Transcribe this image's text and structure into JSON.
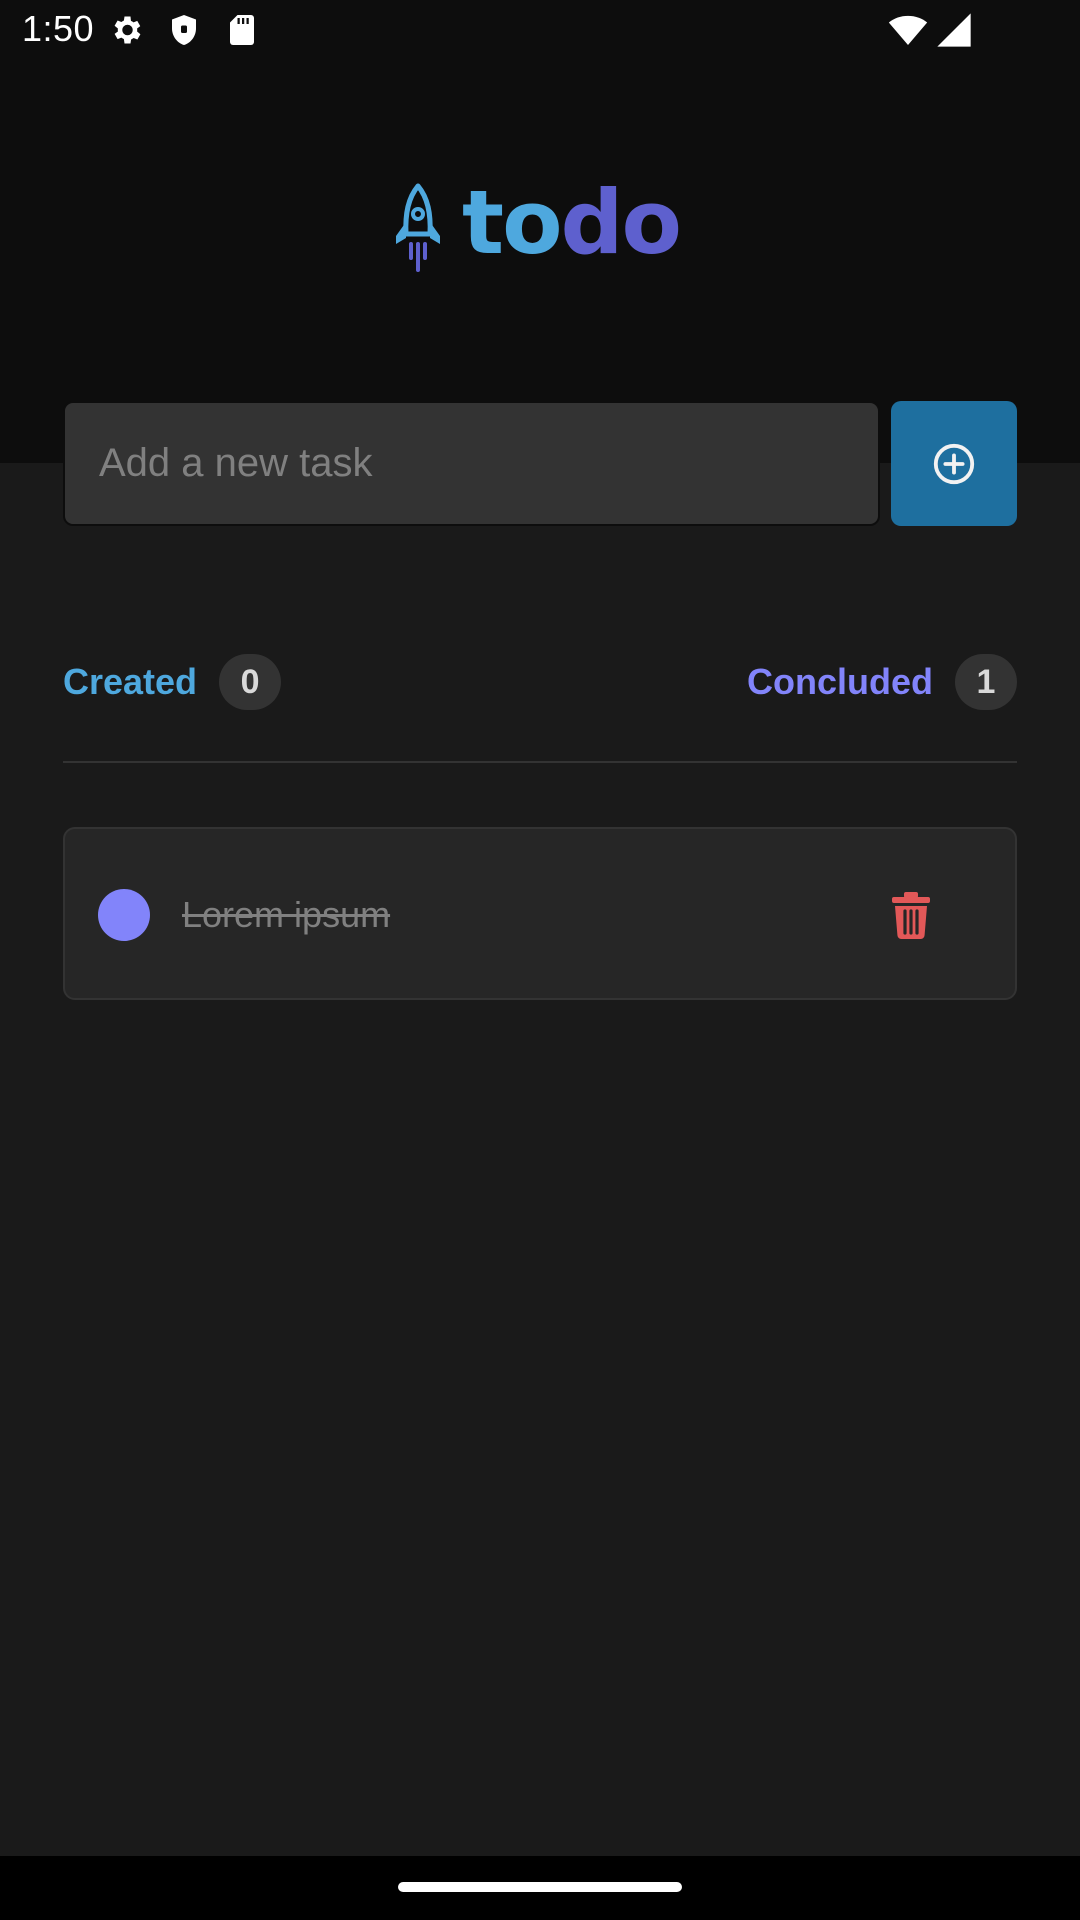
{
  "status_bar": {
    "time": "1:50",
    "icons": [
      "settings-icon",
      "shield-icon",
      "sd-card-icon",
      "wifi-icon",
      "signal-icon"
    ]
  },
  "logo": {
    "icon": "rocket-icon",
    "text_part1": "to",
    "text_part2": "do"
  },
  "new_task": {
    "placeholder": "Add a new task",
    "value": "",
    "button_icon": "plus-circle-icon"
  },
  "counters": {
    "created_label": "Created",
    "created_count": "0",
    "concluded_label": "Concluded",
    "concluded_count": "1"
  },
  "tasks": [
    {
      "text": "Lorem ipsum",
      "done": true,
      "check_icon": "checked-circle-icon",
      "delete_icon": "trash-icon"
    }
  ],
  "colors": {
    "blue": "#4ea8de",
    "purple": "#8284fa",
    "purple_dark": "#5e60ce",
    "button_blue": "#1e6f9f",
    "danger": "#e25858",
    "background": "#1a1a1a",
    "header_background": "#0d0d0d"
  }
}
